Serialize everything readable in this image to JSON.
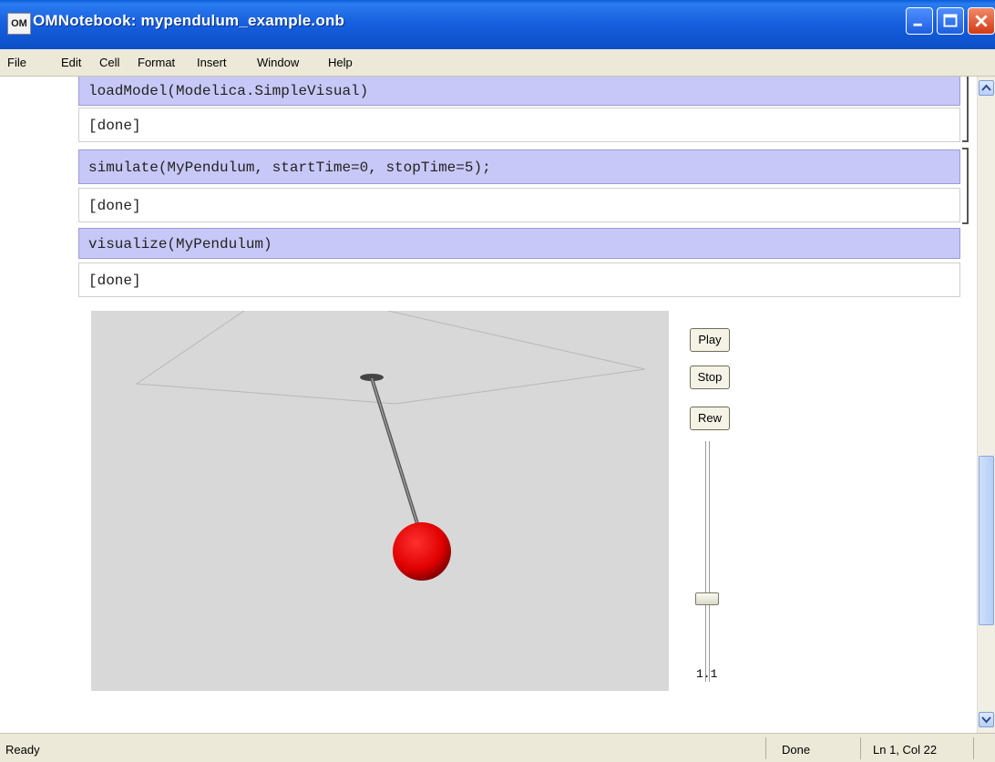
{
  "window": {
    "app_icon_text": "OM",
    "title": "OMNotebook: mypendulum_example.onb"
  },
  "menu": [
    "File",
    "Edit",
    "Cell",
    "Format",
    "Insert",
    "Window",
    "Help"
  ],
  "cells": [
    {
      "input": "loadModel(Modelica.SimpleVisual)",
      "output": "[done]"
    },
    {
      "input": "simulate(MyPendulum, startTime=0, stopTime=5);",
      "output": "[done]"
    },
    {
      "input": "visualize(MyPendulum)",
      "output": "[done]"
    }
  ],
  "visualizer": {
    "play_label": "Play",
    "stop_label": "Stop",
    "rew_label": "Rew",
    "slider_value": "1.1",
    "ball_color": "#e00000"
  },
  "status": {
    "left": "Ready",
    "middle": "Done",
    "position": "Ln 1, Col 22"
  },
  "colors": {
    "input_cell_bg": "#c8c8f8",
    "titlebar": "#1760e0"
  }
}
